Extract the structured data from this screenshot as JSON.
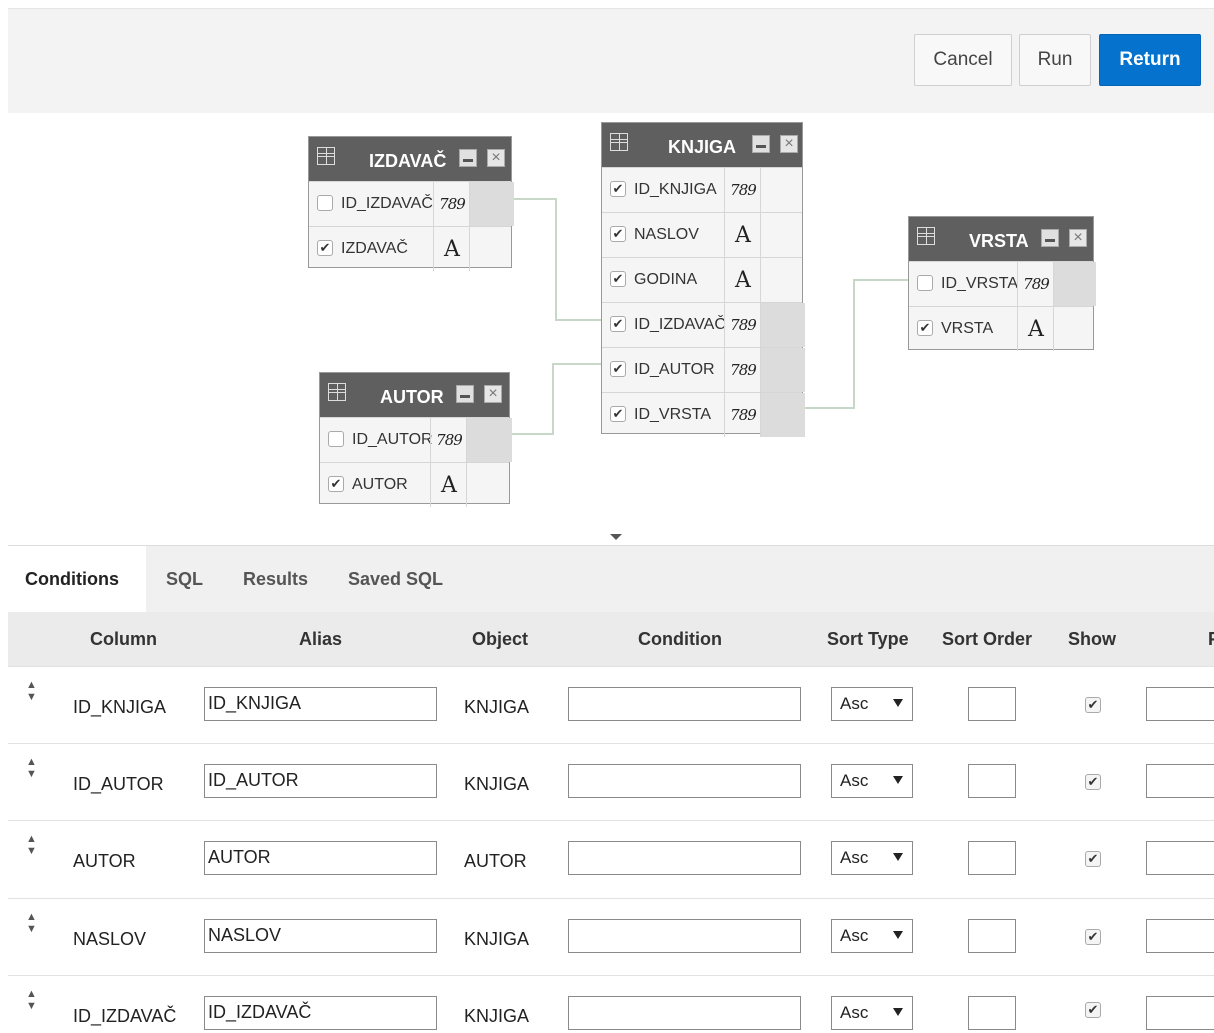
{
  "toolbar": {
    "cancel": "Cancel",
    "run": "Run",
    "return": "Return"
  },
  "tables": {
    "izdavac": {
      "name": "IZDAVAČ",
      "cols": [
        {
          "name": "ID_IZDAVAČ",
          "checked": false,
          "type": "789"
        },
        {
          "name": "IZDAVAČ",
          "checked": true,
          "type": "A"
        }
      ]
    },
    "knjiga": {
      "name": "KNJIGA",
      "cols": [
        {
          "name": "ID_KNJIGA",
          "checked": true,
          "type": "789"
        },
        {
          "name": "NASLOV",
          "checked": true,
          "type": "A"
        },
        {
          "name": "GODINA",
          "checked": true,
          "type": "A"
        },
        {
          "name": "ID_IZDAVAČ",
          "checked": true,
          "type": "789"
        },
        {
          "name": "ID_AUTOR",
          "checked": true,
          "type": "789"
        },
        {
          "name": "ID_VRSTA",
          "checked": true,
          "type": "789"
        }
      ]
    },
    "vrsta": {
      "name": "VRSTA",
      "cols": [
        {
          "name": "ID_VRSTA",
          "checked": false,
          "type": "789"
        },
        {
          "name": "VRSTA",
          "checked": true,
          "type": "A"
        }
      ]
    },
    "autor": {
      "name": "AUTOR",
      "cols": [
        {
          "name": "ID_AUTOR",
          "checked": false,
          "type": "789"
        },
        {
          "name": "AUTOR",
          "checked": true,
          "type": "A"
        }
      ]
    }
  },
  "tabs": [
    "Conditions",
    "SQL",
    "Results",
    "Saved SQL"
  ],
  "grid": {
    "headers": {
      "column": "Column",
      "alias": "Alias",
      "object": "Object",
      "condition": "Condition",
      "sort_type": "Sort Type",
      "sort_order": "Sort Order",
      "show": "Show",
      "func": "F"
    },
    "rows": [
      {
        "column": "ID_KNJIGA",
        "alias": "ID_KNJIGA",
        "object": "KNJIGA",
        "condition": "",
        "sort_type": "Asc",
        "sort_order": "",
        "show": true
      },
      {
        "column": "ID_AUTOR",
        "alias": "ID_AUTOR",
        "object": "KNJIGA",
        "condition": "",
        "sort_type": "Asc",
        "sort_order": "",
        "show": true
      },
      {
        "column": "AUTOR",
        "alias": "AUTOR",
        "object": "AUTOR",
        "condition": "",
        "sort_type": "Asc",
        "sort_order": "",
        "show": true
      },
      {
        "column": "NASLOV",
        "alias": "NASLOV",
        "object": "KNJIGA",
        "condition": "",
        "sort_type": "Asc",
        "sort_order": "",
        "show": true
      },
      {
        "column": "ID_IZDAVAČ",
        "alias": "ID_IZDAVAČ",
        "object": "KNJIGA",
        "condition": "",
        "sort_type": "Asc",
        "sort_order": "",
        "show": true
      }
    ]
  }
}
